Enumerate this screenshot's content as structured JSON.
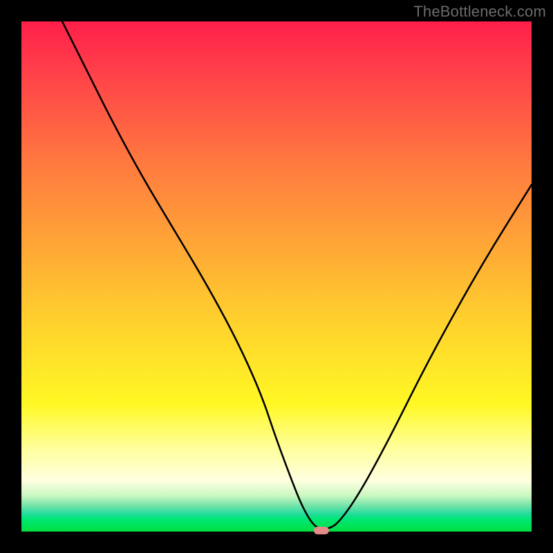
{
  "attribution": "TheBottleneck.com",
  "chart_data": {
    "type": "line",
    "title": "",
    "xlabel": "",
    "ylabel": "",
    "xlim": [
      0,
      100
    ],
    "ylim": [
      0,
      100
    ],
    "series": [
      {
        "name": "bottleneck-curve",
        "x": [
          8,
          12,
          18,
          24,
          30,
          36,
          42,
          47,
          50,
          53,
          55,
          57,
          58.5,
          60,
          62,
          66,
          72,
          80,
          90,
          100
        ],
        "values": [
          100,
          92,
          80,
          69,
          59,
          49,
          38,
          27,
          18,
          10,
          5,
          1.5,
          0.5,
          0.5,
          1.5,
          7,
          18,
          34,
          52,
          68
        ]
      }
    ],
    "annotations": [
      {
        "name": "optimal-marker",
        "x": 58.8,
        "y": 0.2,
        "shape": "pill",
        "color": "#e38b89"
      }
    ],
    "background": "vertical-gradient-red-yellow-green",
    "grid": false,
    "legend": false
  },
  "colors": {
    "frame": "#000000",
    "curve": "#000000",
    "marker": "#e38b89",
    "attribution_text": "#6b6b6b"
  }
}
